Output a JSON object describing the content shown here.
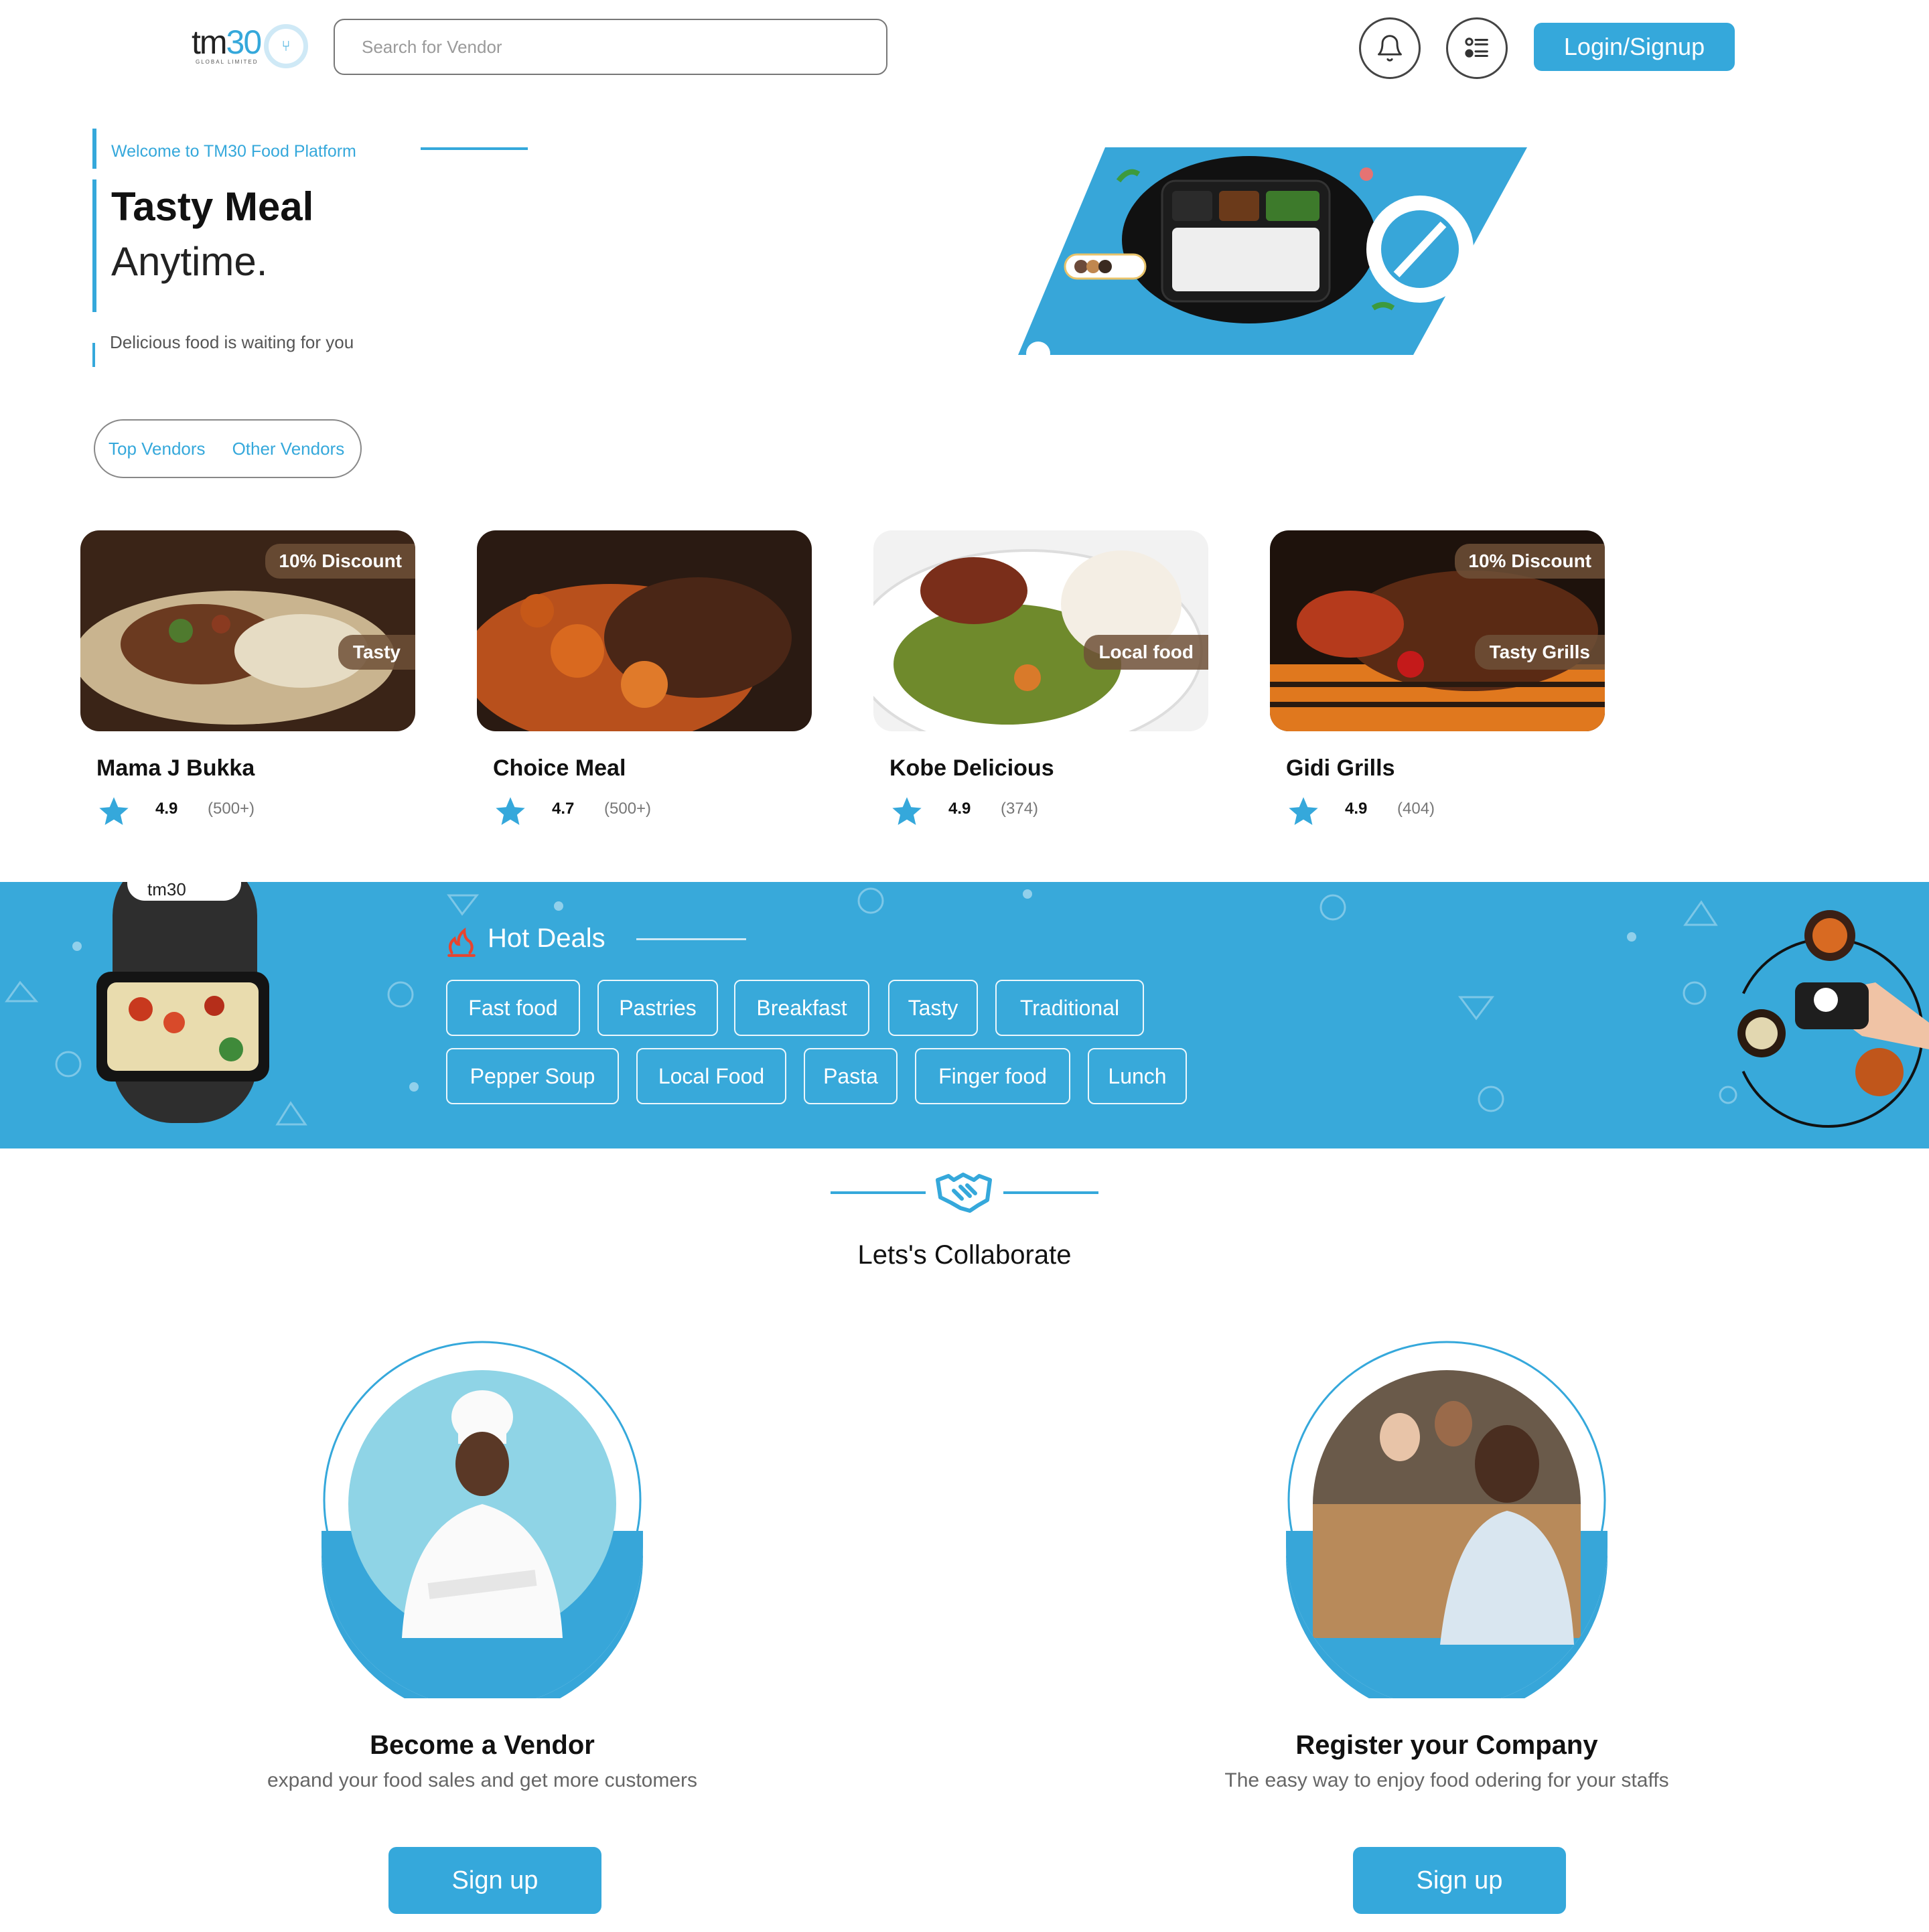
{
  "header": {
    "logo_text": "tm",
    "logo_number": "30",
    "logo_subtitle": "GLOBAL LIMITED",
    "search_placeholder": "Search for Vendor",
    "login_label": "Login/Signup",
    "icons": [
      "bell-icon",
      "menu-list-icon"
    ]
  },
  "hero": {
    "welcome": "Welcome to TM30 Food Platform",
    "title_line1": "Tasty Meal",
    "title_line2": "Anytime.",
    "tagline": "Delicious food is waiting for you",
    "tabs": [
      "Top Vendors",
      "Other Vendors"
    ]
  },
  "vendors": [
    {
      "name": "Mama J Bukka",
      "rating": "4.9",
      "count": "(500+)",
      "discount": "10% Discount",
      "tag": "Tasty"
    },
    {
      "name": "Choice Meal",
      "rating": "4.7",
      "count": "(500+)",
      "discount": "",
      "tag": ""
    },
    {
      "name": "Kobe Delicious",
      "rating": "4.9",
      "count": "(374)",
      "discount": "",
      "tag": "Local food"
    },
    {
      "name": "Gidi Grills",
      "rating": "4.9",
      "count": "(404)",
      "discount": "10% Discount",
      "tag": "Tasty Grills"
    }
  ],
  "hot_deals": {
    "title": "Hot Deals",
    "categories": [
      "Fast food",
      "Pastries",
      "Breakfast",
      "Tasty",
      "Traditional",
      "Pepper Soup",
      "Local Food",
      "Pasta",
      "Finger food",
      "Lunch"
    ]
  },
  "collaborate": {
    "title": "Lets's Collaborate",
    "cards": [
      {
        "heading": "Become a Vendor",
        "sub": "expand your food sales and get more customers",
        "button": "Sign up"
      },
      {
        "heading": "Register your Company",
        "sub": "The easy way to enjoy food odering for your staffs",
        "button": "Sign up"
      }
    ]
  },
  "colors": {
    "accent": "#35a8db",
    "band": "#38a9da",
    "badge": "#6e5037"
  }
}
